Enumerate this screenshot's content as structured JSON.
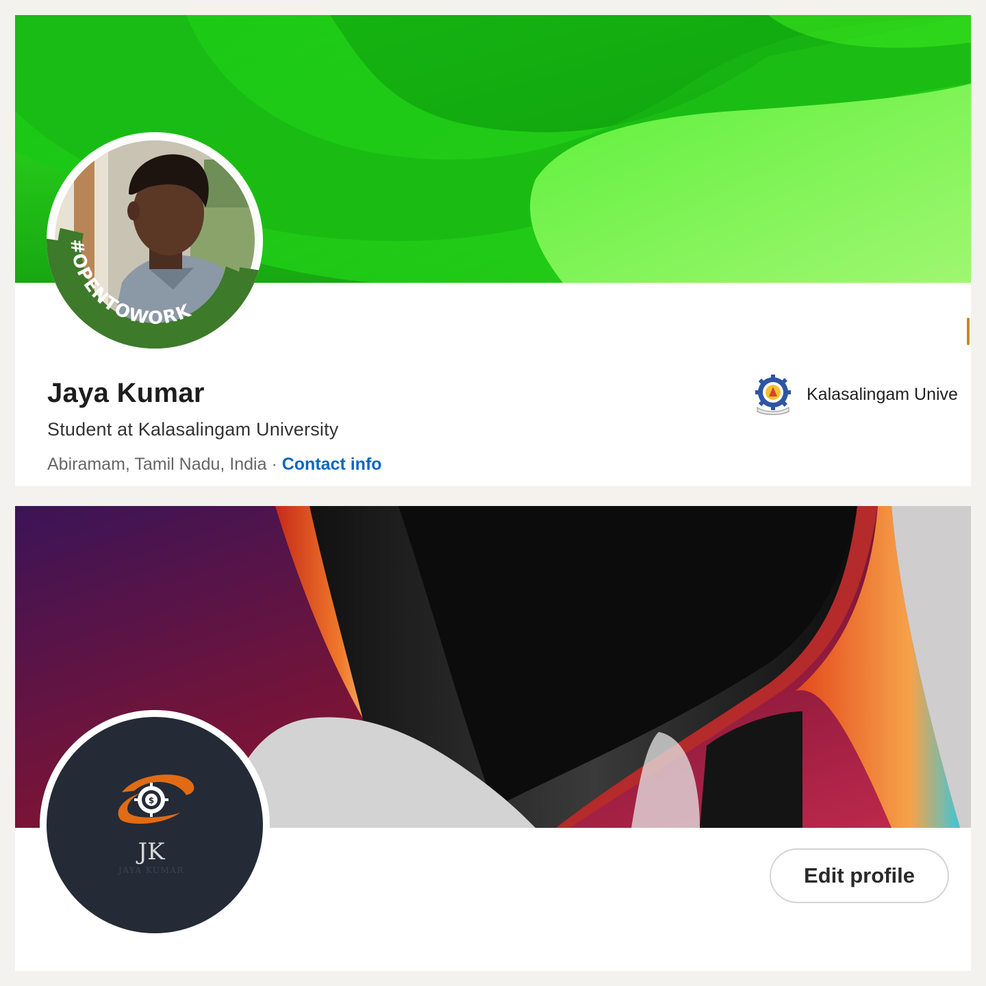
{
  "profile1": {
    "name": "Jaya Kumar",
    "headline": "Student at Kalasalingam University",
    "location": "Abiramam, Tamil Nadu, India",
    "separator": " · ",
    "contact_link": "Contact info",
    "badge": "#OPENTOWORK",
    "education": {
      "name": "Kalasalingam Unive",
      "logo_icon": "university-crest-icon"
    },
    "banner_colors": [
      "#1fc41a",
      "#36e61e",
      "#17a212"
    ]
  },
  "profile2": {
    "logo_initials": "JK",
    "logo_subtitle": "JAYA KUMAR",
    "logo_icon": "dollar-target-icon",
    "edit_button": "Edit profile",
    "accent_color": "#e06b14"
  }
}
